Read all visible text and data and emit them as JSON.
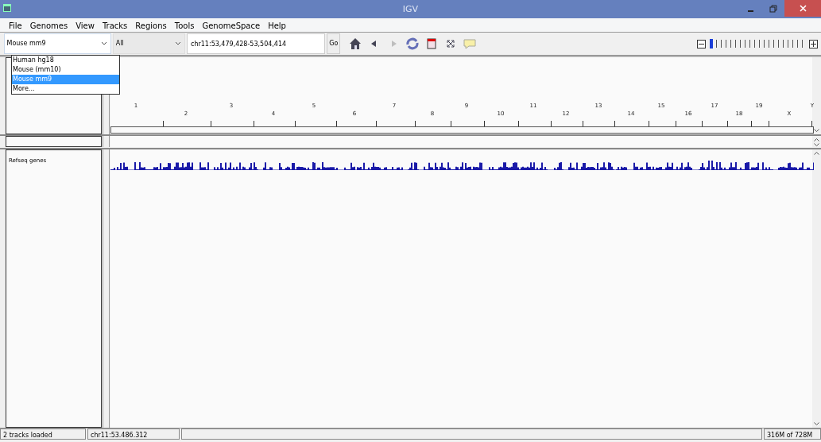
{
  "window": {
    "title": "IGV"
  },
  "menu": [
    "File",
    "Genomes",
    "View",
    "Tracks",
    "Regions",
    "Tools",
    "GenomeSpace",
    "Help"
  ],
  "genome_combo": {
    "value": "Mouse mm9",
    "expanded": true
  },
  "genome_options": [
    {
      "label": "Human hg18",
      "selected": false
    },
    {
      "label": "Mouse (mm10)",
      "selected": false
    },
    {
      "label": "Mouse mm9",
      "selected": true
    },
    {
      "label": "More...",
      "selected": false
    }
  ],
  "chromosome_combo": {
    "value": "All"
  },
  "locus_field": {
    "value": "chr11:53,479,428-53,504,414"
  },
  "go_button": "Go",
  "toolbar_buttons": [
    {
      "kind": "home",
      "disabled": false
    },
    {
      "kind": "back",
      "disabled": false
    },
    {
      "kind": "forward",
      "disabled": true
    },
    {
      "kind": "refresh",
      "disabled": false
    },
    {
      "kind": "region",
      "disabled": false
    },
    {
      "kind": "resize",
      "disabled": false
    },
    {
      "kind": "popup",
      "disabled": false
    }
  ],
  "zoom": {
    "level": 0
  },
  "chromosomes": [
    "1",
    "2",
    "3",
    "4",
    "5",
    "6",
    "7",
    "8",
    "9",
    "10",
    "11",
    "12",
    "13",
    "14",
    "15",
    "16",
    "17",
    "18",
    "19",
    "X",
    "Y"
  ],
  "tracks": [
    {
      "name": "Refseq genes"
    }
  ],
  "status_bar": {
    "message": "2 tracks loaded",
    "position": "chr11:53.486.312",
    "memory": "316M of 728M"
  }
}
